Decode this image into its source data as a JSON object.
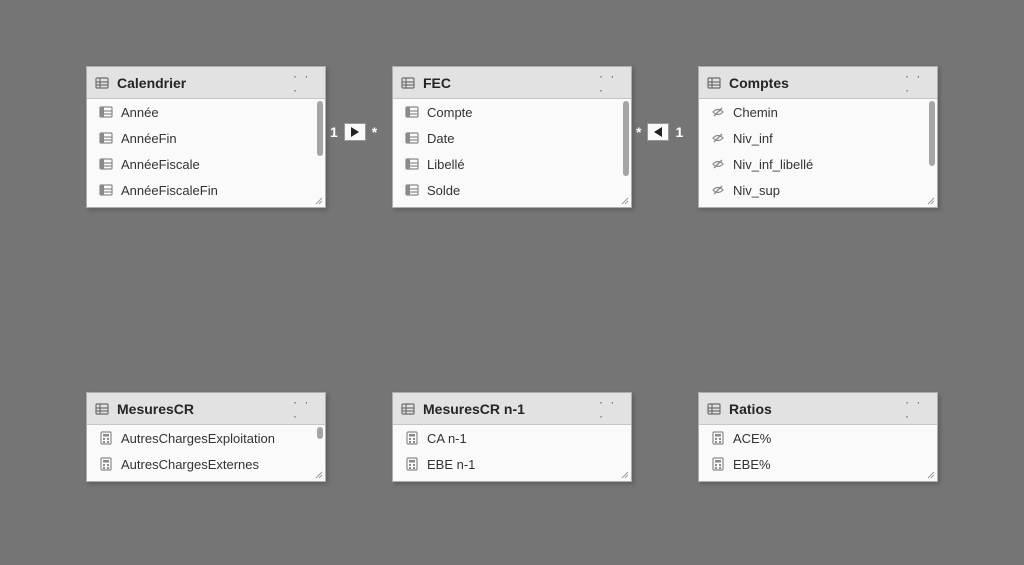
{
  "tables": {
    "calendrier": {
      "title": "Calendrier",
      "fields": [
        "Année",
        "AnnéeFin",
        "AnnéeFiscale",
        "AnnéeFiscaleFin"
      ]
    },
    "fec": {
      "title": "FEC",
      "fields": [
        "Compte",
        "Date",
        "Libellé",
        "Solde"
      ]
    },
    "comptes": {
      "title": "Comptes",
      "fields": [
        "Chemin",
        "Niv_inf",
        "Niv_inf_libellé",
        "Niv_sup"
      ]
    },
    "mesurescr": {
      "title": "MesuresCR",
      "fields": [
        "AutresChargesExploitation",
        "AutresChargesExternes"
      ]
    },
    "mesurescrn1": {
      "title": "MesuresCR n-1",
      "fields": [
        "CA n-1",
        "EBE n-1"
      ]
    },
    "ratios": {
      "title": "Ratios",
      "fields": [
        "ACE%",
        "EBE%"
      ]
    }
  },
  "relationships": {
    "cal_fec": {
      "left": "1",
      "right": "*"
    },
    "fec_comptes": {
      "left": "*",
      "right": "1"
    }
  },
  "labels": {
    "more": "· · ·"
  }
}
